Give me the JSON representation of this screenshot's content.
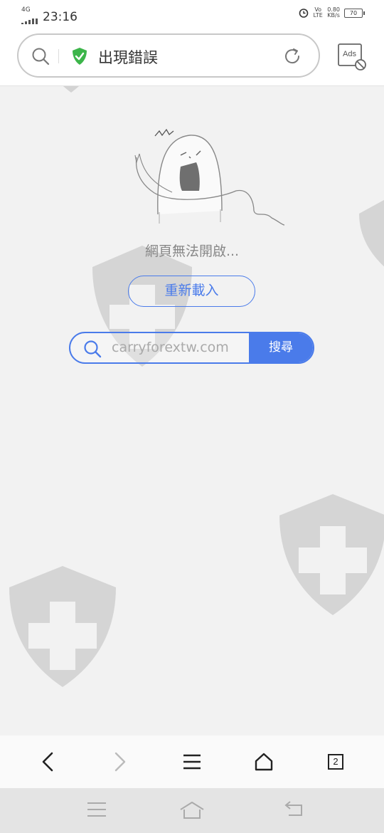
{
  "status_bar": {
    "network": "4G",
    "time": "23:16",
    "volte": "Vo LTE",
    "speed_value": "0.80",
    "speed_unit": "KB/s",
    "battery": "70"
  },
  "header": {
    "page_title": "出現錯誤",
    "ads_label": "Ads"
  },
  "error_page": {
    "message": "網頁無法開啟...",
    "reload_label": "重新載入",
    "search_query": "carryforextw.com",
    "search_button_label": "搜尋"
  },
  "toolbar": {
    "tab_count": "2"
  },
  "colors": {
    "accent": "#4a7bea",
    "shield_green": "#3cb54a",
    "watermark": "#cfcfcf"
  },
  "icons": [
    "back-icon",
    "forward-icon",
    "menu-icon",
    "home-icon",
    "tabs-icon",
    "search-icon",
    "reload-icon",
    "ads-block-icon",
    "secure-shield-icon"
  ]
}
